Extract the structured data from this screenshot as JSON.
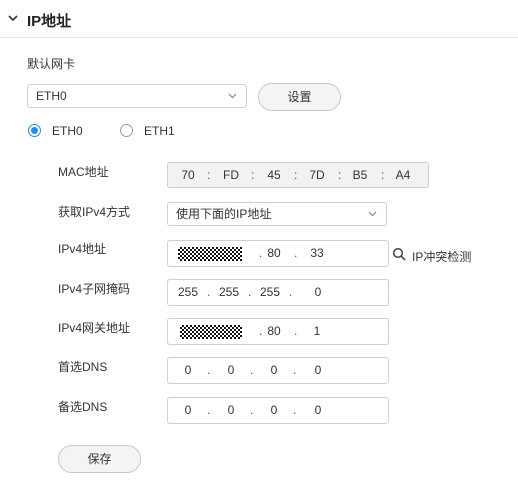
{
  "section": {
    "title": "IP地址"
  },
  "nic": {
    "label": "默认网卡",
    "selected": "ETH0",
    "set_button": "设置",
    "radios": [
      {
        "label": "ETH0",
        "checked": true
      },
      {
        "label": "ETH1",
        "checked": false
      }
    ]
  },
  "form": {
    "mac": {
      "label": "MAC地址",
      "parts": [
        "70",
        "FD",
        "45",
        "7D",
        "B5",
        "A4"
      ],
      "separator": ":"
    },
    "ipv4_mode": {
      "label": "获取IPv4方式",
      "selected": "使用下面的IP地址"
    },
    "ipv4": {
      "label": "IPv4地址",
      "parts": [
        "80",
        "33"
      ],
      "separator": "."
    },
    "subnet": {
      "label": "IPv4子网掩码",
      "parts": [
        "255",
        "255",
        "255",
        "0"
      ],
      "separator": "."
    },
    "gateway": {
      "label": "IPv4网关地址",
      "parts": [
        "80",
        "1"
      ],
      "separator": "."
    },
    "dns1": {
      "label": "首选DNS",
      "parts": [
        "0",
        "0",
        "0",
        "0"
      ],
      "separator": "."
    },
    "dns2": {
      "label": "备选DNS",
      "parts": [
        "0",
        "0",
        "0",
        "0"
      ],
      "separator": "."
    }
  },
  "ip_conflict": {
    "label": "IP冲突检测"
  },
  "save_button": "保存",
  "icons": {
    "chevron": "chevron-down-icon",
    "arrow": "select-arrow-icon",
    "search": "search-icon"
  }
}
